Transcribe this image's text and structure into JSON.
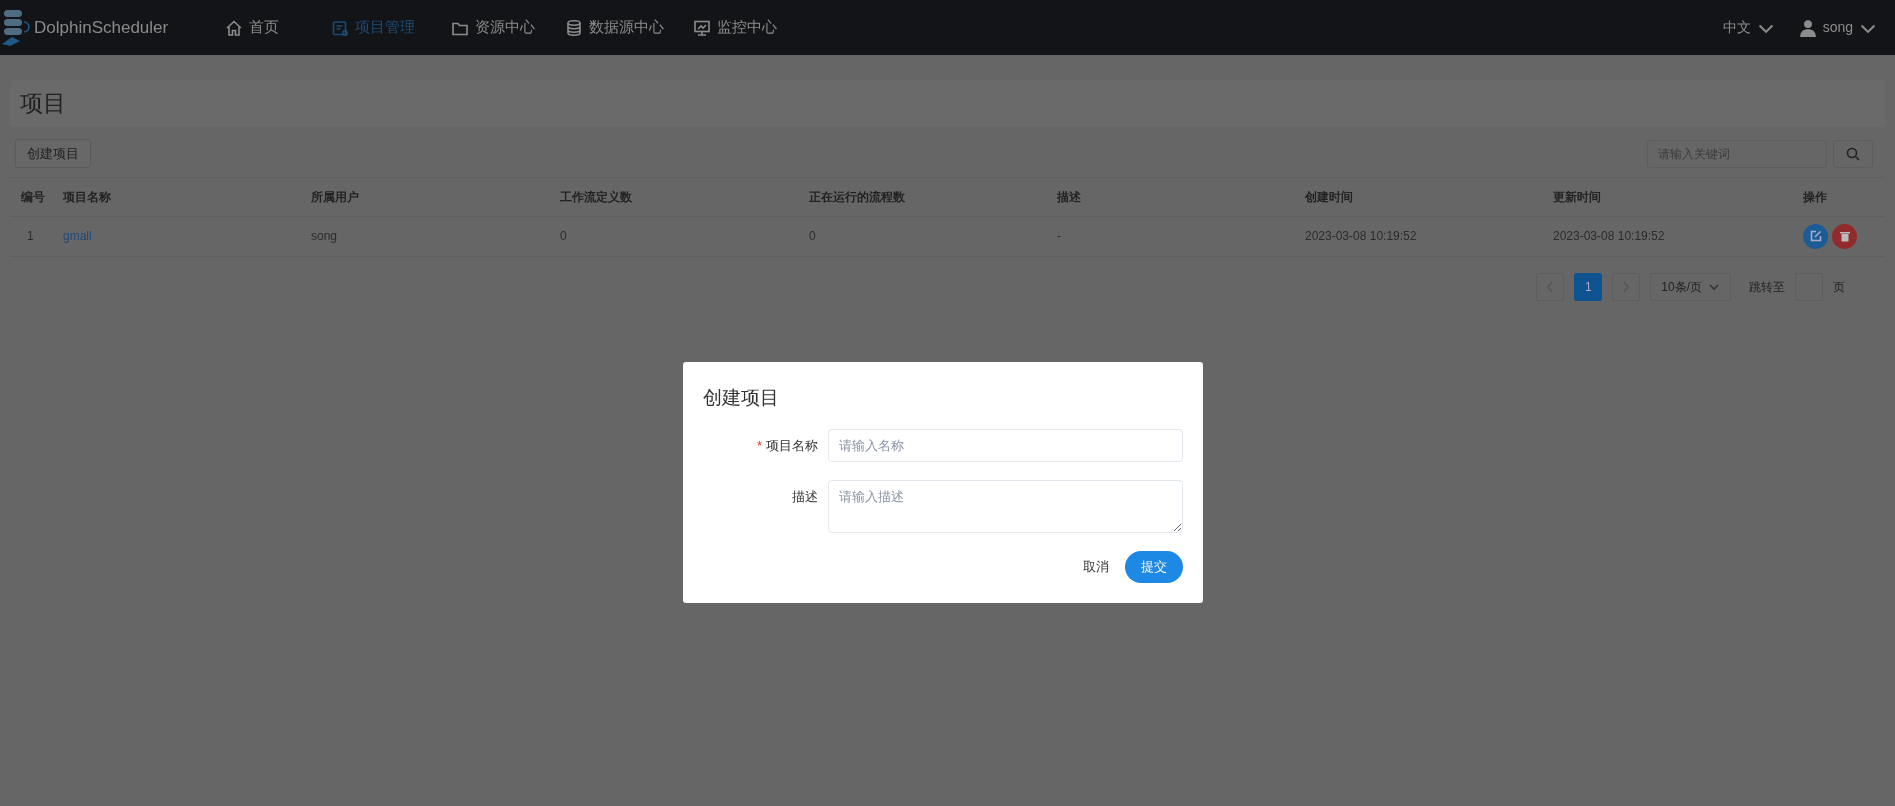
{
  "brand": "DolphinScheduler",
  "nav": [
    {
      "label": "首页",
      "selected": false
    },
    {
      "label": "项目管理",
      "selected": true
    },
    {
      "label": "资源中心",
      "selected": false
    },
    {
      "label": "数据源中心",
      "selected": false
    },
    {
      "label": "监控中心",
      "selected": false
    }
  ],
  "language": "中文",
  "user": "song",
  "page_title": "项目",
  "create_button": "创建项目",
  "search": {
    "placeholder": "请输入关键词"
  },
  "table": {
    "columns": [
      "编号",
      "项目名称",
      "所属用户",
      "工作流定义数",
      "正在运行的流程数",
      "描述",
      "创建时间",
      "更新时间",
      "操作"
    ],
    "rows": [
      {
        "cells": [
          "1",
          "gmall",
          "song",
          "0",
          "0",
          "-",
          "2023-03-08 10:19:52",
          "2023-03-08 10:19:52"
        ]
      }
    ]
  },
  "pagination": {
    "pages": [
      {
        "label": "1",
        "selected": true
      }
    ],
    "page_size": "10条/页",
    "jump_label": "跳转至",
    "page_unit": "页"
  },
  "dialog": {
    "title": "创建项目",
    "fields": [
      {
        "kind": "input",
        "marker": "*",
        "label": "项目名称",
        "placeholder": "请输入名称"
      },
      {
        "kind": "textarea",
        "label": "描述",
        "placeholder": "请输入描述"
      }
    ],
    "buttons": [
      {
        "kind": "text",
        "label": "取消"
      },
      {
        "kind": "primary",
        "label": "提交"
      }
    ]
  }
}
